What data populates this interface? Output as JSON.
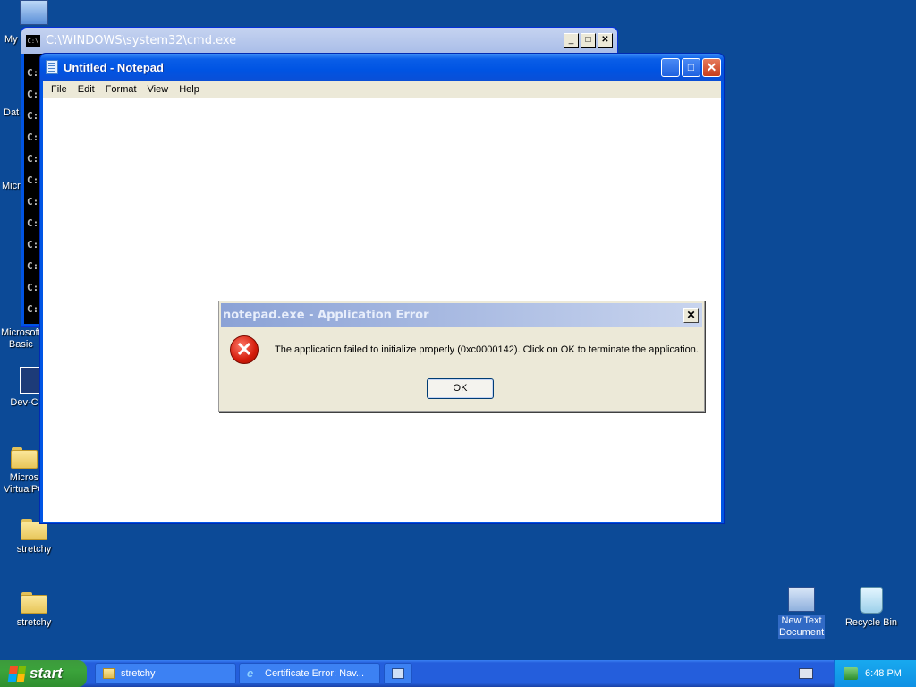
{
  "desktop": {
    "icons_left": [
      {
        "label": "My"
      },
      {
        "label": "Dat"
      },
      {
        "label": "Micr"
      },
      {
        "label": "Microsoft Basic"
      },
      {
        "label": "Dev-C"
      },
      {
        "label": "Micros VirtualPC"
      },
      {
        "label": "stretchy"
      },
      {
        "label": "stretchy"
      }
    ],
    "icons_right": [
      {
        "label": "New Text Document"
      },
      {
        "label": "Recycle Bin"
      }
    ]
  },
  "cmd_window": {
    "title": "C:\\WINDOWS\\system32\\cmd.exe",
    "icon_text": "C:\\",
    "minimize": "_",
    "maximize": "□",
    "close": "✕",
    "console_lines": [
      "C:",
      "C:",
      "C:",
      "C:",
      "C:",
      "C:",
      "C:",
      "C:",
      "C:",
      "C:",
      "C:",
      "C:"
    ]
  },
  "notepad": {
    "title": "Untitled - Notepad",
    "minimize": "_",
    "maximize": "□",
    "close": "✕",
    "menu": [
      "File",
      "Edit",
      "Format",
      "View",
      "Help"
    ],
    "content": ""
  },
  "error_dialog": {
    "title": "notepad.exe - Application Error",
    "close": "✕",
    "icon_glyph": "✕",
    "message": "The application failed to initialize properly (0xc0000142). Click on OK to terminate the application.",
    "ok_label": "OK"
  },
  "taskbar": {
    "start_label": "start",
    "buttons": [
      {
        "label": "stretchy"
      },
      {
        "label": "Certificate Error: Nav..."
      },
      {
        "label": ""
      }
    ],
    "clock": "6:48 PM"
  },
  "colors": {
    "desktop": "#0c4a97",
    "xp_title_blue": "#0054e3",
    "dialog_face": "#ece9d8",
    "taskbar_blue": "#245edc",
    "start_green": "#3ba33b"
  }
}
